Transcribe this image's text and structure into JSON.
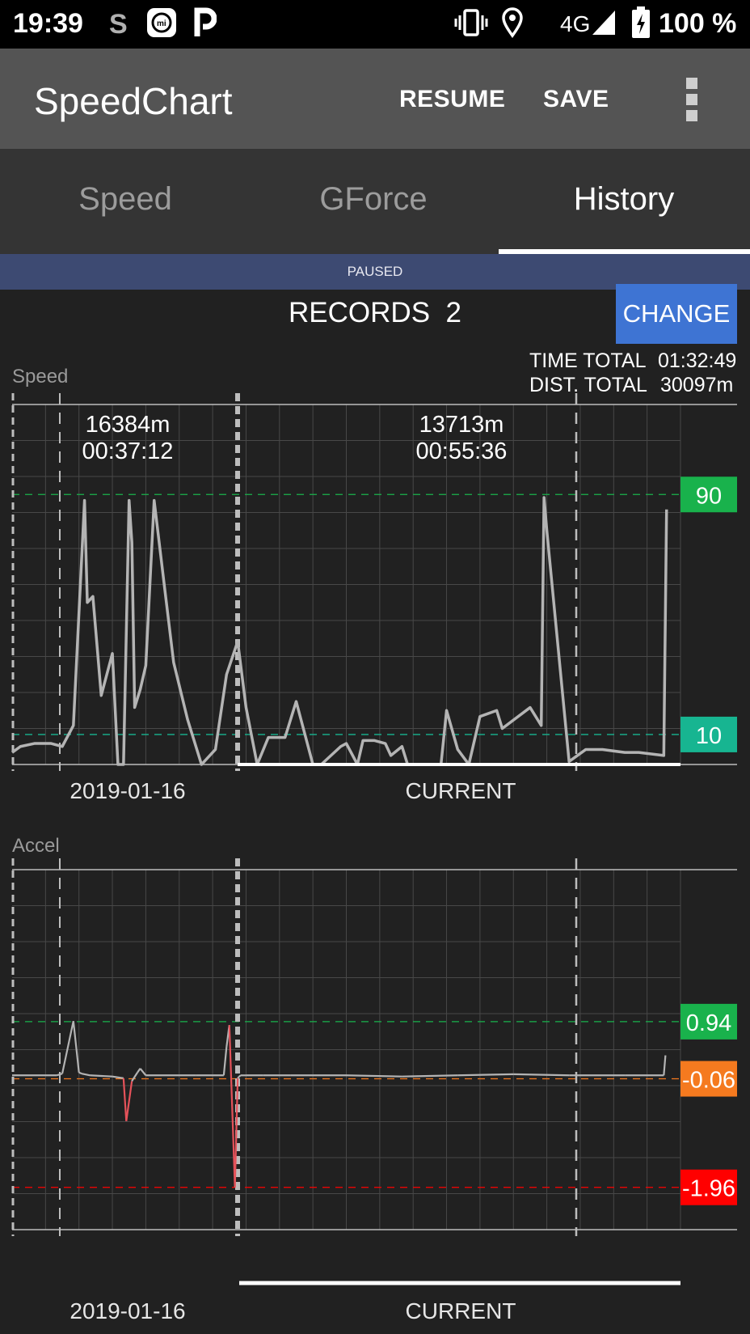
{
  "status_bar": {
    "time": "19:39",
    "network": "4G",
    "battery": "100 %",
    "icons": [
      "s-icon",
      "mi-fit-icon",
      "p-icon",
      "vibrate-icon",
      "location-icon",
      "signal-icon",
      "battery-charging-icon"
    ]
  },
  "app_bar": {
    "title": "SpeedChart",
    "resume_label": "RESUME",
    "save_label": "SAVE",
    "menu_icon": "overflow-menu-icon"
  },
  "tabs": [
    {
      "label": "Speed",
      "active": false
    },
    {
      "label": "GForce",
      "active": false
    },
    {
      "label": "History",
      "active": true
    }
  ],
  "banner": {
    "text": "PAUSED"
  },
  "records": {
    "label": "RECORDS  2",
    "change_label": "CHANGE"
  },
  "totals": {
    "time_label": "TIME TOTAL",
    "time_value": "01:32:49",
    "dist_label": "DIST. TOTAL",
    "dist_value": "30097m"
  },
  "colors": {
    "background": "#212121",
    "app_bar": "#545454",
    "tab_bar": "#343434",
    "banner": "#3d4a72",
    "change_button": "#3e74d3",
    "speed_high": "#19b24c",
    "speed_low": "#17b591",
    "accel_high": "#19b24c",
    "accel_avg": "#f57a1f",
    "accel_low": "#ff0000",
    "accel_negative_line": "#e5525a",
    "line": "#b4b4b4"
  },
  "chart_data": [
    {
      "type": "line",
      "title": "Speed",
      "segments": [
        {
          "dist": "16384m",
          "duration": "00:37:12",
          "date": "2019-01-16"
        },
        {
          "dist": "13713m",
          "duration": "00:55:36",
          "date": "CURRENT"
        }
      ],
      "markers": [
        {
          "label": "90",
          "value": 90,
          "color": "#19b24c"
        },
        {
          "label": "10",
          "value": 10,
          "color": "#17b591"
        }
      ],
      "ylim": [
        0,
        120
      ],
      "grid": true,
      "series": [
        {
          "x": [
            0,
            1.5,
            4,
            7,
            9,
            11,
            13,
            13.5,
            14.5,
            16,
            18,
            19,
            20,
            21,
            21.5,
            22,
            23,
            24,
            25.5,
            27.5,
            29,
            31.5,
            34,
            36.5,
            38.5,
            40.5,
            42,
            44,
            46,
            49,
            51,
            54,
            55.5,
            59,
            60,
            62,
            63,
            65,
            67,
            68,
            70,
            71,
            73,
            77,
            78,
            80,
            82,
            84,
            87,
            88,
            93,
            95,
            95.5,
            96,
            100,
            103,
            105,
            106,
            110,
            112.5,
            117,
            117.5
          ],
          "y": [
            4,
            6,
            7,
            7,
            6,
            13,
            88,
            54,
            56,
            23,
            37,
            0,
            0,
            88,
            74,
            19,
            25,
            33,
            88,
            57,
            34,
            15,
            0,
            5,
            30,
            41,
            19,
            0,
            9,
            9,
            21,
            0,
            0,
            6,
            7,
            0,
            8,
            8,
            7,
            3,
            6,
            0,
            0,
            0,
            18,
            5,
            0,
            16,
            18,
            12,
            19,
            13,
            89,
            78,
            1,
            5,
            5,
            5,
            4,
            4,
            3,
            85
          ]
        }
      ]
    },
    {
      "type": "line",
      "title": "Accel",
      "segments": [
        {
          "date": "2019-01-16"
        },
        {
          "date": "CURRENT"
        }
      ],
      "markers": [
        {
          "label": "0.94",
          "value": 0.94,
          "color": "#19b24c"
        },
        {
          "label": "-0.06",
          "value": -0.06,
          "color": "#f57a1f"
        },
        {
          "label": "-1.96",
          "value": -1.96,
          "color": "#ff0000"
        }
      ],
      "ylim": [
        -2.7,
        3.6
      ],
      "grid": true,
      "series": [
        {
          "x": [
            0,
            8,
            9,
            11,
            12,
            12.5,
            14,
            18,
            20,
            20.5,
            21.5,
            22.5,
            23,
            24,
            33,
            38,
            38.5,
            39,
            40,
            40.5,
            41,
            42,
            45,
            50,
            60,
            70,
            80,
            90,
            100,
            110,
            117,
            117.3
          ],
          "y": [
            0,
            0,
            0.03,
            0.95,
            0.05,
            0.03,
            0,
            -0.02,
            -0.05,
            -0.8,
            -0.1,
            0.05,
            0.12,
            0,
            0,
            0,
            0.5,
            0.88,
            -1.96,
            -0.05,
            0,
            0,
            0,
            0,
            0,
            -0.02,
            0,
            0.02,
            0,
            0,
            0,
            0.35
          ]
        }
      ]
    }
  ]
}
